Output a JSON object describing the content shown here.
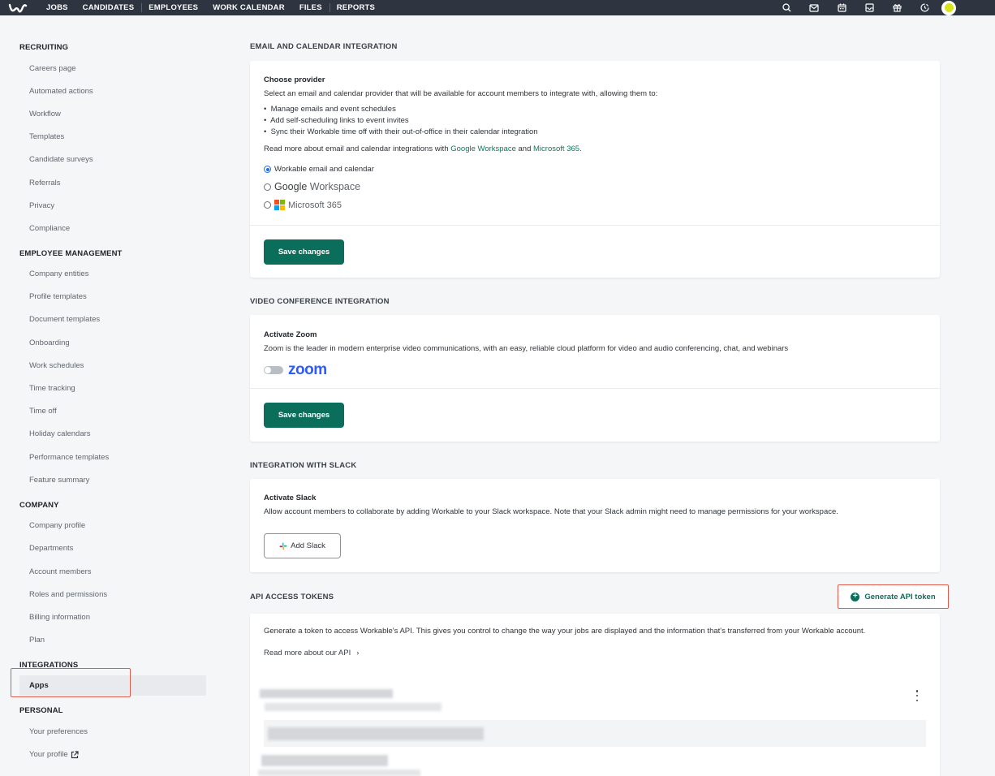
{
  "topnav": {
    "items": [
      "JOBS",
      "CANDIDATES",
      "EMPLOYEES",
      "WORK CALENDAR",
      "FILES",
      "REPORTS"
    ],
    "icons": [
      "search-icon",
      "mail-icon",
      "calendar-icon",
      "inbox-icon",
      "gift-icon",
      "timer-icon"
    ]
  },
  "sidebar": {
    "recruiting": {
      "title": "RECRUITING",
      "items": [
        "Careers page",
        "Automated actions",
        "Workflow",
        "Templates",
        "Candidate surveys",
        "Referrals",
        "Privacy",
        "Compliance"
      ]
    },
    "employee_management": {
      "title": "EMPLOYEE MANAGEMENT",
      "items": [
        "Company entities",
        "Profile templates",
        "Document templates",
        "Onboarding",
        "Work schedules",
        "Time tracking",
        "Time off",
        "Holiday calendars",
        "Performance templates",
        "Feature summary"
      ]
    },
    "company": {
      "title": "COMPANY",
      "items": [
        "Company profile",
        "Departments",
        "Account members",
        "Roles and permissions",
        "Billing information",
        "Plan"
      ]
    },
    "integrations": {
      "title": "INTEGRATIONS",
      "items": [
        "Apps"
      ]
    },
    "personal": {
      "title": "PERSONAL",
      "items": [
        "Your preferences",
        "Your profile"
      ]
    }
  },
  "email_calendar": {
    "section_title": "EMAIL AND CALENDAR INTEGRATION",
    "heading": "Choose provider",
    "description": "Select an email and calendar provider that will be available for account members to integrate with, allowing them to:",
    "bullets": [
      "Manage emails and event schedules",
      "Add self-scheduling links to event invites",
      "Sync their Workable time off with their out-of-office in their calendar integration"
    ],
    "read_more_prefix": "Read more about email and calendar integrations with ",
    "read_more_link1": "Google Workspace",
    "read_more_and": " and ",
    "read_more_link2": "Microsoft 365",
    "read_more_suffix": ".",
    "options": {
      "workable": "Workable email and calendar",
      "google_g": "Google",
      "google_rest": " Workspace",
      "microsoft": "Microsoft 365"
    },
    "selected": "workable",
    "save_label": "Save changes"
  },
  "video": {
    "section_title": "VIDEO CONFERENCE INTEGRATION",
    "heading": "Activate Zoom",
    "description": "Zoom is the leader in modern enterprise video communications, with an easy, reliable cloud platform for video and audio conferencing, chat, and webinars",
    "zoom_logo": "zoom",
    "toggle_on": false,
    "save_label": "Save changes"
  },
  "slack": {
    "section_title": "INTEGRATION WITH SLACK",
    "heading": "Activate Slack",
    "description": "Allow account members to collaborate by adding Workable to your Slack workspace. Note that your Slack admin might need to manage permissions for your workspace.",
    "button_label": "Add Slack"
  },
  "api": {
    "section_title": "API ACCESS TOKENS",
    "generate_label": "Generate API token",
    "description": "Generate a token to access Workable's API. This gives you control to change the way your jobs are displayed and the information that's transferred from your Workable account.",
    "read_more": "Read more about our API",
    "read_more_arrow": "›"
  },
  "colors": {
    "topbar": "#2e3440",
    "primary": "#0b6e5b",
    "link": "#0b7a5e",
    "highlight": "#e05b4b",
    "radio_selected": "#1a6fe0",
    "zoom_blue": "#2d5bff"
  }
}
